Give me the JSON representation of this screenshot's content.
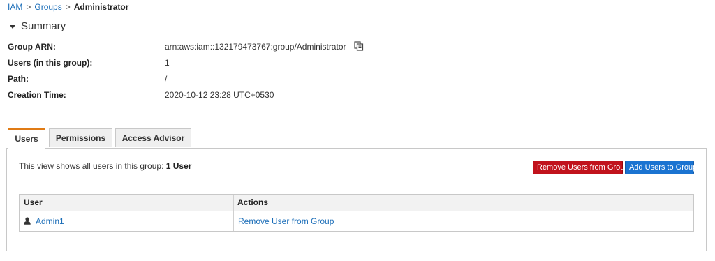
{
  "breadcrumb": {
    "items": [
      "IAM",
      "Groups"
    ],
    "separator": ">",
    "current": "Administrator"
  },
  "summary": {
    "title": "Summary",
    "fields": [
      {
        "label": "Group ARN:",
        "value": "arn:aws:iam::132179473767:group/Administrator"
      },
      {
        "label": "Users (in this group):",
        "value": "1"
      },
      {
        "label": "Path:",
        "value": "/"
      },
      {
        "label": "Creation Time:",
        "value": "2020-10-12 23:28 UTC+0530"
      }
    ]
  },
  "tabs": [
    {
      "label": "Users",
      "active": true
    },
    {
      "label": "Permissions",
      "active": false
    },
    {
      "label": "Access Advisor",
      "active": false
    }
  ],
  "users_panel": {
    "info_prefix": "This view shows all users in this group: ",
    "info_count": "1 User",
    "remove_button": "Remove Users from Group",
    "add_button": "Add Users to Group",
    "table": {
      "headers": [
        "User",
        "Actions"
      ],
      "rows": [
        {
          "user": "Admin1",
          "action": "Remove User from Group"
        }
      ]
    }
  },
  "colors": {
    "link": "#1a6db8",
    "danger": "#c1121c",
    "primary": "#1a73d1",
    "active_tab_accent": "#e07b15"
  },
  "icons": [
    "caret-down-icon",
    "copy-icon",
    "user-icon"
  ]
}
